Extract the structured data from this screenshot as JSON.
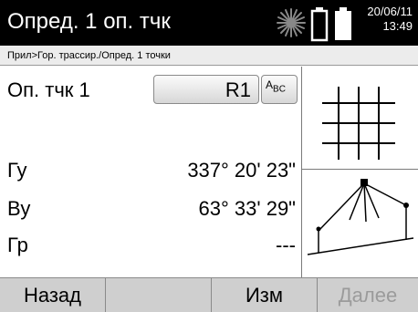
{
  "header": {
    "title": "Опред. 1 оп. тчк",
    "date": "20/06/11",
    "time": "13:49",
    "icons": [
      "sun-brightness-icon",
      "battery-icon"
    ]
  },
  "breadcrumb": "Прил>Гор. трассир./Опред. 1 точки",
  "main": {
    "point_label": "Оп. тчк 1",
    "point_value": "R1",
    "abc_label": "A",
    "abc_sub": "B",
    "abc_sub2": "C",
    "rows": [
      {
        "label": "Гу",
        "value": "337° 20' 23\""
      },
      {
        "label": "Ву",
        "value": "63° 33' 29\""
      },
      {
        "label": "Гр",
        "value": "---"
      }
    ]
  },
  "softkeys": [
    {
      "label": "Назад",
      "enabled": true
    },
    {
      "label": "",
      "enabled": true
    },
    {
      "label": "Изм",
      "enabled": true
    },
    {
      "label": "Далее",
      "enabled": false
    }
  ],
  "colors": {
    "titlebar": "#000000",
    "breadcrumb_bg": "#ececec",
    "softkey_bg": "#cfcfcf",
    "disabled_text": "#9b9b9b"
  }
}
